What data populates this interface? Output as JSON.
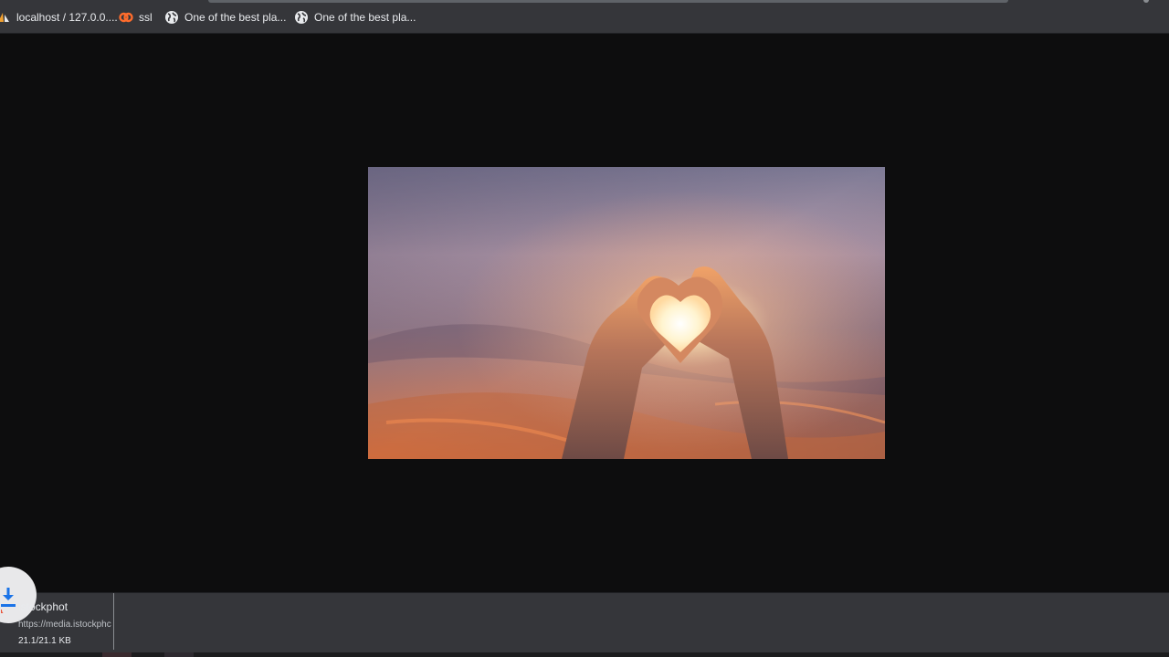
{
  "bookmarks": [
    {
      "label": "localhost / 127.0.0....",
      "icon": "phpmyadmin-sail-icon"
    },
    {
      "label": "ssl",
      "icon": "cpanel-icon"
    },
    {
      "label": "One of the best pla...",
      "icon": "globe-icon"
    },
    {
      "label": "One of the best pla...",
      "icon": "globe-icon"
    }
  ],
  "viewer": {
    "image": "heart-hands-sunset-photo"
  },
  "download": {
    "filename": "istockphot",
    "url": "https://media.istockphc",
    "size": "21.1/21.1 KB",
    "progress": 1.0,
    "icon": "download-arrow-icon"
  },
  "colors": {
    "bookmarks_bar": "#35363a",
    "viewer_background": "#0d0d0e",
    "download_shelf": "#35363a",
    "download_arrow": "#1a73e8"
  }
}
